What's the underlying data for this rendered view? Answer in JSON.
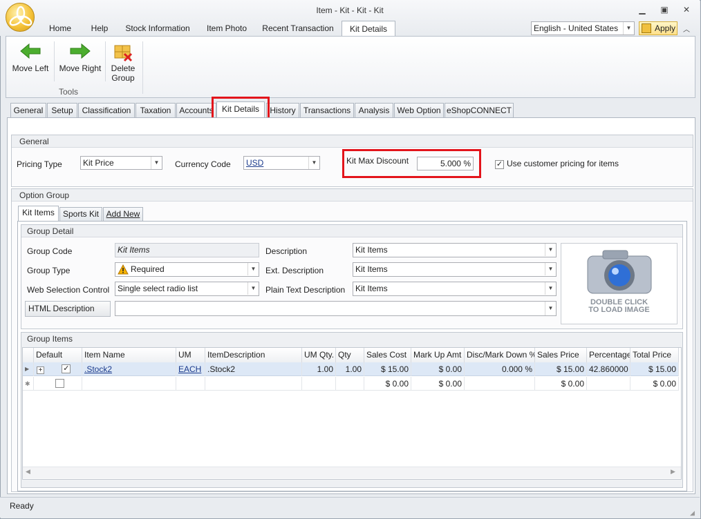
{
  "window": {
    "title": "Item - Kit - Kit - Kit"
  },
  "ribbon_tabs": [
    "Home",
    "Help",
    "Stock Information",
    "Item Photo",
    "Recent Transaction",
    "Kit Details"
  ],
  "language": {
    "value": "English - United States"
  },
  "apply_label": "Apply",
  "tools": {
    "move_left": "Move Left",
    "move_right": "Move Right",
    "delete_group_line1": "Delete",
    "delete_group_line2": "Group",
    "group_label": "Tools"
  },
  "tabs": [
    "General",
    "Setup",
    "Classification",
    "Taxation",
    "Accounts",
    "Kit Details",
    "History",
    "Transactions",
    "Analysis",
    "Web Option",
    "eShopCONNECT"
  ],
  "general": {
    "header": "General",
    "pricing_type_label": "Pricing Type",
    "pricing_type_value": "Kit Price",
    "currency_code_label": "Currency Code",
    "currency_code_value": "USD",
    "kit_max_discount_label": "Kit Max Discount",
    "kit_max_discount_value": "5.000 %",
    "use_customer_pricing_label": "Use customer pricing for items"
  },
  "option_group": {
    "header": "Option Group",
    "subtabs": [
      "Kit Items",
      "Sports Kit",
      "Add New"
    ]
  },
  "group_detail": {
    "header": "Group Detail",
    "group_code_label": "Group Code",
    "group_code_value": "Kit Items",
    "group_type_label": "Group Type",
    "group_type_value": "Required",
    "web_selection_label": "Web Selection Control",
    "web_selection_value": "Single select radio list",
    "html_description_label": "HTML Description",
    "description_label": "Description",
    "description_value": "Kit Items",
    "ext_description_label": "Ext. Description",
    "ext_description_value": "Kit Items",
    "plain_text_label": "Plain Text Description",
    "plain_text_value": "Kit Items",
    "image_line1": "DOUBLE CLICK",
    "image_line2": "TO LOAD IMAGE"
  },
  "group_items": {
    "header": "Group Items",
    "columns": [
      "Default",
      "Item Name",
      "UM",
      "ItemDescription",
      "UM Qty.",
      "Qty",
      "Sales Cost",
      "Mark Up Amt",
      "Disc/Mark Down %",
      "Sales Price",
      "Percentage",
      "Total Price"
    ],
    "rows": [
      {
        "item_name": ".Stock2",
        "um": "EACH",
        "description": ".Stock2",
        "um_qty": "1.00",
        "qty": "1.00",
        "sales_cost": "$ 15.00",
        "markup": "$ 0.00",
        "disc": "0.000 %",
        "sales_price": "$ 15.00",
        "percentage": "42.860000",
        "total_price": "$ 15.00"
      }
    ],
    "new_row": {
      "sales_cost": "$ 0.00",
      "markup": "$ 0.00",
      "sales_price": "$ 0.00",
      "total_price": "$ 0.00"
    }
  },
  "status": {
    "text": "Ready"
  },
  "colors": {
    "highlight": "#e3141b",
    "accent": "#f5c33b"
  }
}
